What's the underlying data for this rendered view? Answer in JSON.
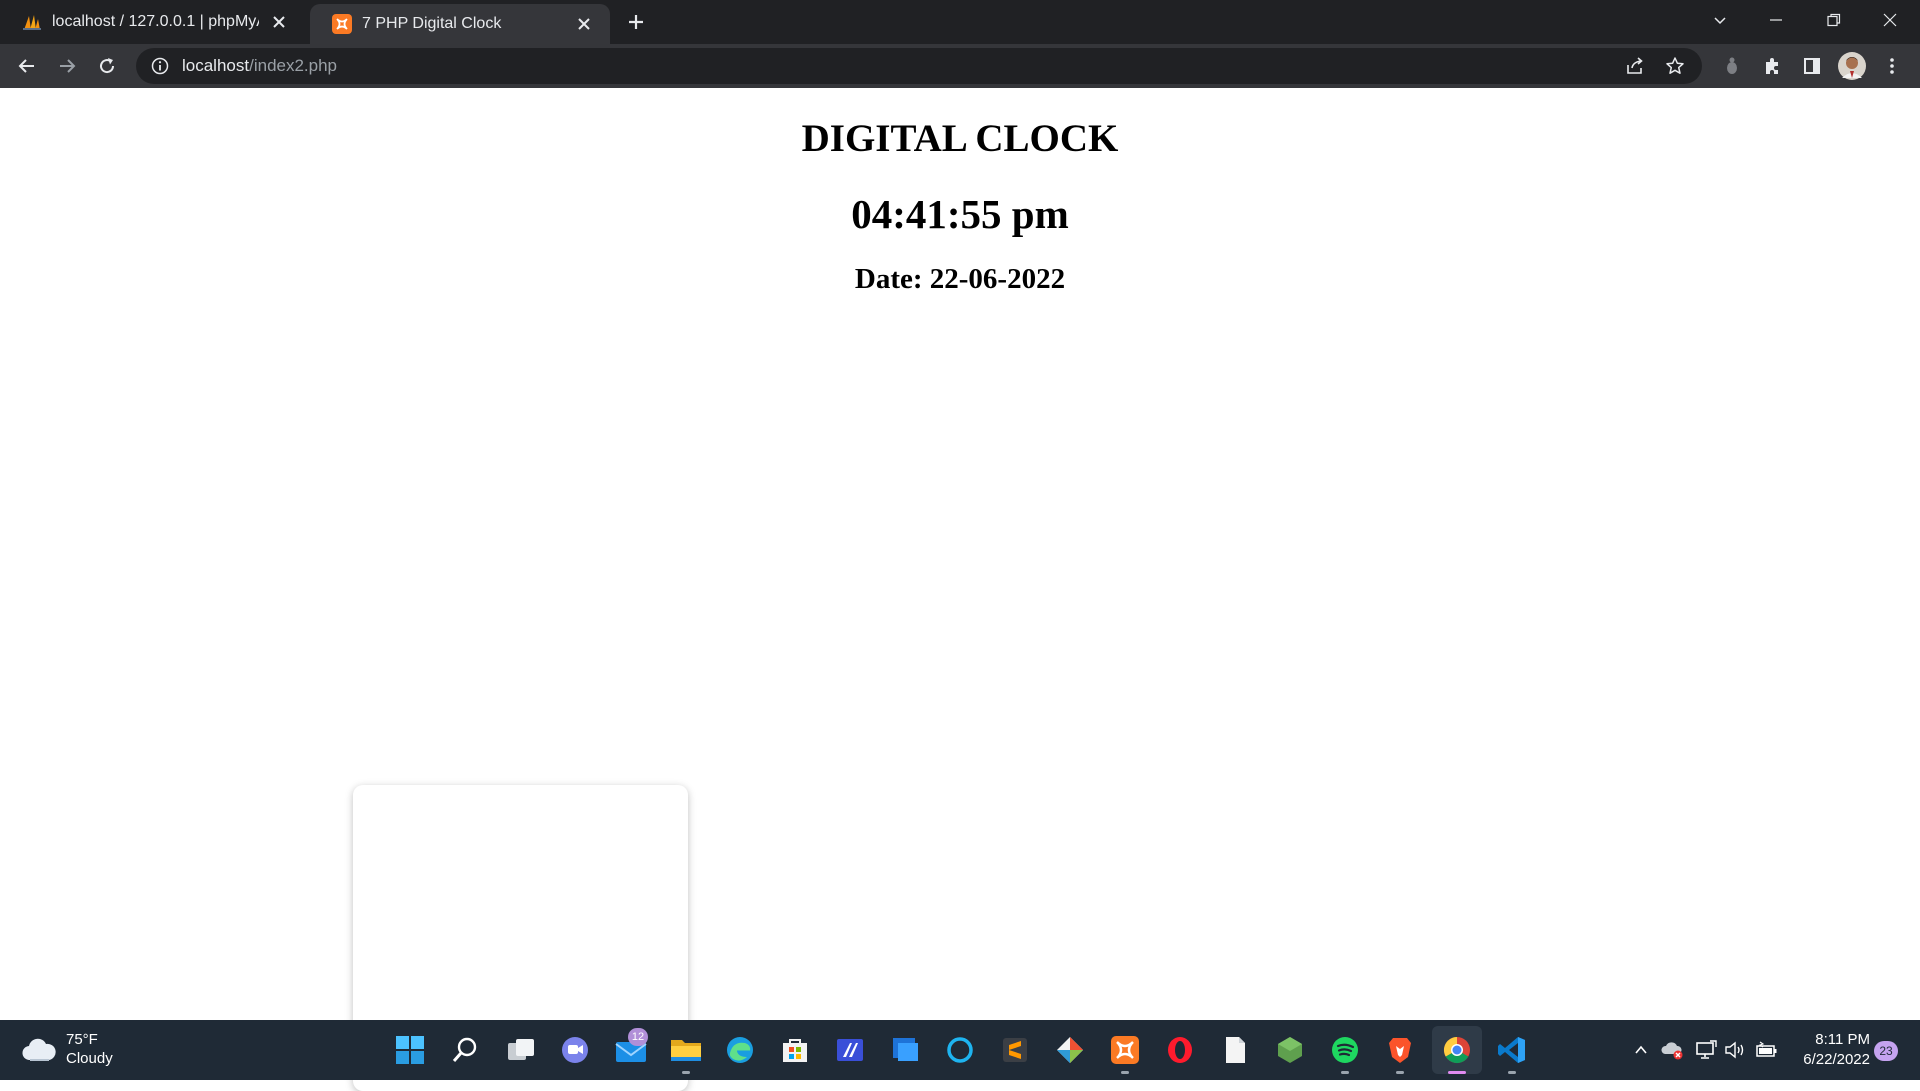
{
  "browser": {
    "tabs": [
      {
        "title": "localhost / 127.0.0.1 | phpMyAdm",
        "favicon": "phpmyadmin-icon",
        "active": false
      },
      {
        "title": "7 PHP Digital Clock",
        "favicon": "xampp-icon",
        "active": true
      }
    ],
    "url_host": "localhost",
    "url_path": "/index2.php"
  },
  "page": {
    "title": "DIGITAL CLOCK",
    "time": "04:41:55 pm",
    "date": "Date: 22-06-2022"
  },
  "taskbar": {
    "weather_temp": "75°F",
    "weather_desc": "Cloudy",
    "mail_badge": "12",
    "time": "8:11 PM",
    "date": "6/22/2022",
    "notification_count": "23"
  },
  "colors": {
    "tabstrip": "#202124",
    "toolbar": "#35363a",
    "taskbar": "#1f2a36",
    "accent": "#e08bf0"
  }
}
